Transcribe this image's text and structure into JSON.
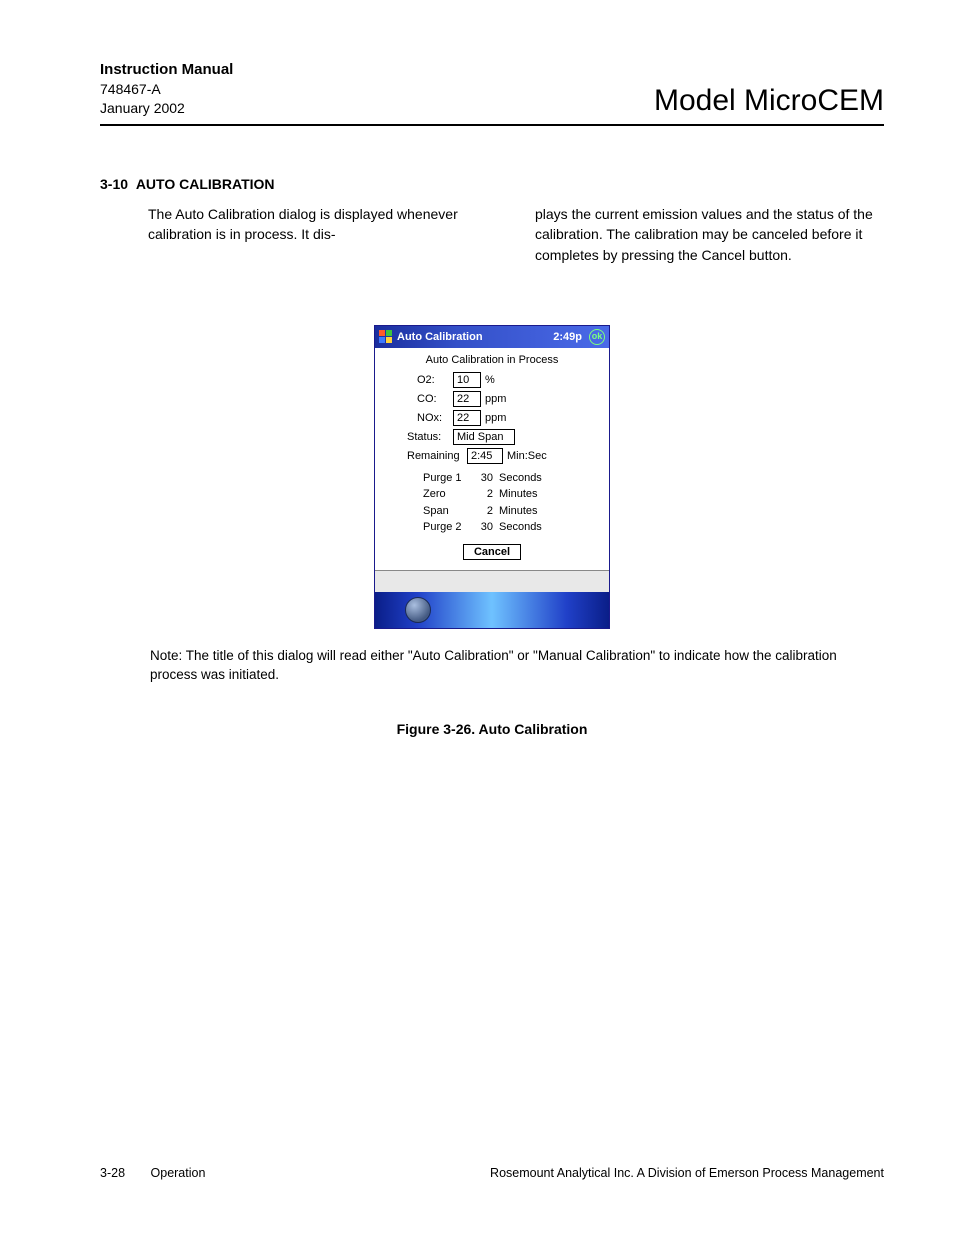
{
  "header": {
    "manual_title": "Instruction Manual",
    "doc_number": "748467-A",
    "date": "January 2002",
    "model_title": "Model MicroCEM"
  },
  "section": {
    "number": "3-10",
    "title": "AUTO CALIBRATION"
  },
  "paragraphs": {
    "col1": "The Auto Calibration dialog is displayed whenever calibration is in process.  It dis-",
    "col2": "plays the current emission values and the status of the calibration.  The calibration may be canceled before it completes by pressing the Cancel button."
  },
  "pda": {
    "topbar_title": "Auto Calibration",
    "time": "2:49p",
    "ok_label": "ok",
    "process_msg": "Auto Calibration in Process",
    "o2": {
      "label": "O2:",
      "value": "10",
      "unit": "%"
    },
    "co": {
      "label": "CO:",
      "value": "22",
      "unit": "ppm"
    },
    "nox": {
      "label": "NOx:",
      "value": "22",
      "unit": "ppm"
    },
    "status": {
      "label": "Status:",
      "value": "Mid Span"
    },
    "remaining": {
      "label": "Remaining",
      "value": "2:45",
      "unit": "Min:Sec"
    },
    "rows": [
      {
        "name": "Purge 1",
        "val": "30",
        "unit": "Seconds"
      },
      {
        "name": "Zero",
        "val": "2",
        "unit": "Minutes"
      },
      {
        "name": "Span",
        "val": "2",
        "unit": "Minutes"
      },
      {
        "name": "Purge 2",
        "val": "30",
        "unit": "Seconds"
      }
    ],
    "cancel_label": "Cancel"
  },
  "note": "Note: The title of this dialog will read either \"Auto Calibration\" or \"Manual Calibration\" to indicate how the calibration process was initiated.",
  "figure_caption": "Figure 3-26.  Auto Calibration",
  "footer": {
    "page_num": "3-28",
    "chapter": "Operation",
    "company": "Rosemount Analytical Inc.    A Division of Emerson Process Management"
  }
}
